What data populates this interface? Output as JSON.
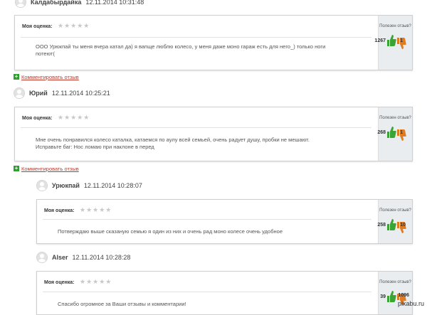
{
  "rating_label": "Моя оценка:",
  "useful_label": "Полезен отзыв?",
  "stars": "★★★★★",
  "comment_link": "Комментировать отзыв",
  "reviews": [
    {
      "author": "Калдабырдайка",
      "date": "12.11.2014 10:31:48",
      "text_line1": "ООО Урюкпай ты меня вчера катал да) я вапще люблю колесо, у меня даже моно гараж есть для него_) только ноги",
      "text_line2": "потеют(",
      "up": "1267",
      "down": "1"
    },
    {
      "author": "Юрий",
      "date": "12.11.2014 10:25:21",
      "text_line1": "Мне очень понравился колесо каталка, катаемся по аулу всей семьей, очень радует душу, пробки не мешают.",
      "text_line2": "Исправьте баг: Нос ломаю при наклоне в перед",
      "up": "268",
      "down": "1"
    },
    {
      "author": "Урюкпай",
      "date": "12.11.2014 10:28:07",
      "text_line1": "Потверждаю выше сказаную семью я один из них и очень рад моно колесе очень удобное",
      "text_line2": "",
      "up": "258",
      "down": "10"
    },
    {
      "author": "Alser",
      "date": "12.11.2014 10:28:28",
      "text_line1": "Спасибо огромное за Ваши отзывы и комментарии!",
      "text_line2": "",
      "up": "39",
      "down": "1096"
    }
  ],
  "watermark": "pikabu.ru",
  "colors": {
    "thumb_up": "#3aa435",
    "thumb_down": "#e07b22",
    "link": "#c0392b",
    "plus": "#2f9e2f",
    "sidebar": "#e9edf0"
  }
}
